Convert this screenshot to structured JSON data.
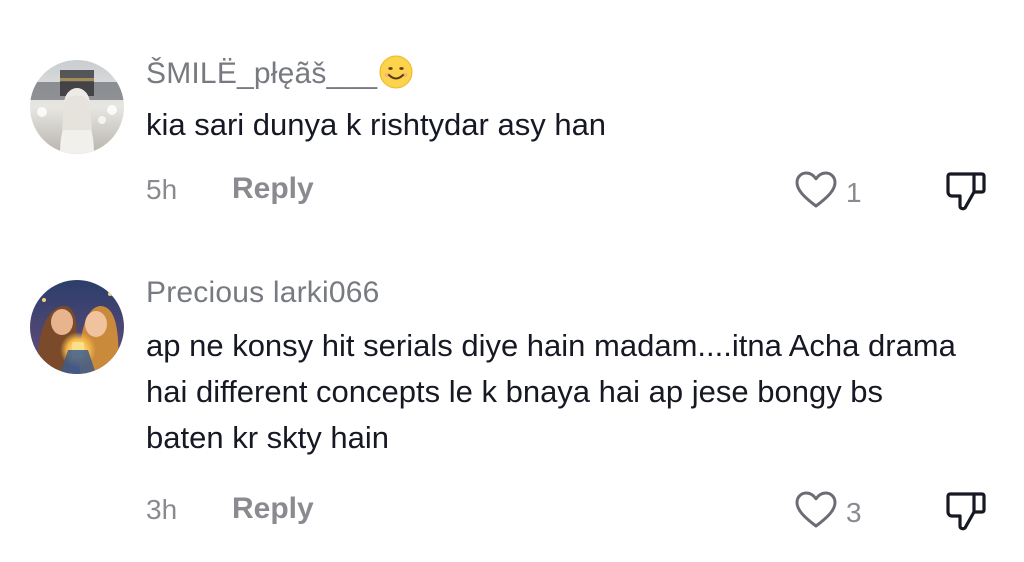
{
  "comments": [
    {
      "username": "ŠMILË_płęãš___",
      "emoji": "smiling-face-emoji",
      "text": "kia sari dunya k rishtydar asy han",
      "time": "5h",
      "reply_label": "Reply",
      "likes": "1"
    },
    {
      "username": "Precious larki066",
      "text": "ap ne konsy hit serials diye hain madam....itna Acha drama hai different concepts le k bnaya hai ap jese bongy bs baten kr skty hain",
      "time": "3h",
      "reply_label": "Reply",
      "likes": "3"
    }
  ],
  "icons": {
    "like": "heart-outline-icon",
    "dislike": "thumbs-down-icon"
  },
  "colors": {
    "text": "#161823",
    "muted": "#8a8b91",
    "username": "#777a80"
  }
}
